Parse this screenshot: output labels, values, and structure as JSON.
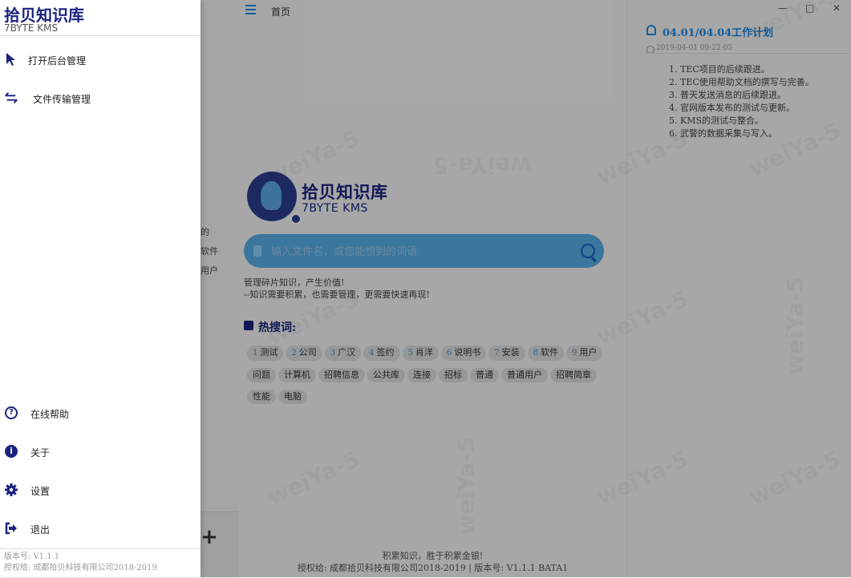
{
  "background": {
    "left_column_peek": [
      "的",
      "软件",
      "",
      "用户"
    ],
    "topbar": {
      "page_tab": "首页"
    },
    "logo": {
      "title": "拾贝知识库",
      "subtitle": "7BYTE KMS"
    },
    "search": {
      "placeholder": "输入文件名，或您能想到的词语"
    },
    "slogan": {
      "line1": "管理碎片知识，产生价值!",
      "line2": "--知识需要积累，也需要管理，更需要快速再现!"
    },
    "hot_words": {
      "title": "热搜词:",
      "tags": [
        {
          "num": "1",
          "label": "测试"
        },
        {
          "num": "2",
          "label": "公司"
        },
        {
          "num": "3",
          "label": "广汉"
        },
        {
          "num": "4",
          "label": "签约"
        },
        {
          "num": "5",
          "label": "肖洋"
        },
        {
          "num": "6",
          "label": "说明书"
        },
        {
          "num": "7",
          "label": "安装"
        },
        {
          "num": "8",
          "label": "软件"
        },
        {
          "num": "9",
          "label": "用户"
        },
        {
          "num": "",
          "label": "问题"
        },
        {
          "num": "",
          "label": "计算机"
        },
        {
          "num": "",
          "label": "招聘信息"
        },
        {
          "num": "",
          "label": "公共库"
        },
        {
          "num": "",
          "label": "连接"
        },
        {
          "num": "",
          "label": "招标"
        },
        {
          "num": "",
          "label": "普通"
        },
        {
          "num": "",
          "label": "普通用户"
        },
        {
          "num": "",
          "label": "招聘简章"
        },
        {
          "num": "",
          "label": "性能"
        },
        {
          "num": "",
          "label": "电脑"
        }
      ]
    },
    "footer": {
      "line1": "积累知识，胜于积累金银!",
      "line2": "授权给: 成都拾贝科技有限公司2018-2019 | 版本号: V1.1.1 BATA1"
    },
    "plan": {
      "title": "04.01/04.04工作计划",
      "time": "2019-04-01 09:22:05",
      "items": [
        "1. TEC项目的后续跟进。",
        "2. TEC使用帮助文档的撰写与完善。",
        "3. 普天发送消息的后续跟进。",
        "4. 官网版本发布的测试与更新。",
        "5. KMS的测试与整合。",
        "6. 武警的数据采集与写入。"
      ]
    },
    "window_controls": {
      "minimize": "—",
      "maximize": "□",
      "close": "✕"
    },
    "watermark": "weiYa-5"
  },
  "drawer": {
    "title": "拾贝知识库",
    "subtitle": "7BYTE KMS",
    "top_items": [
      {
        "icon": "cursor-icon",
        "label": "打开后台管理"
      },
      {
        "icon": "transfer-icon",
        "label": "文件传输管理"
      }
    ],
    "bottom_items": [
      {
        "icon": "help-icon",
        "label": "在线帮助"
      },
      {
        "icon": "info-icon",
        "label": "关于"
      },
      {
        "icon": "gear-icon",
        "label": "设置"
      },
      {
        "icon": "logout-icon",
        "label": "退出"
      }
    ],
    "version_line": "版本号:  V1.1.1",
    "license_line": "授权给: 成都拾贝科技有限公司2018-2019"
  },
  "colors": {
    "brand_dark": "#1a237e",
    "accent_blue": "#1e88e5",
    "search_bg": "#58aee8",
    "overlay": "rgba(0,0,0,0.32)"
  }
}
